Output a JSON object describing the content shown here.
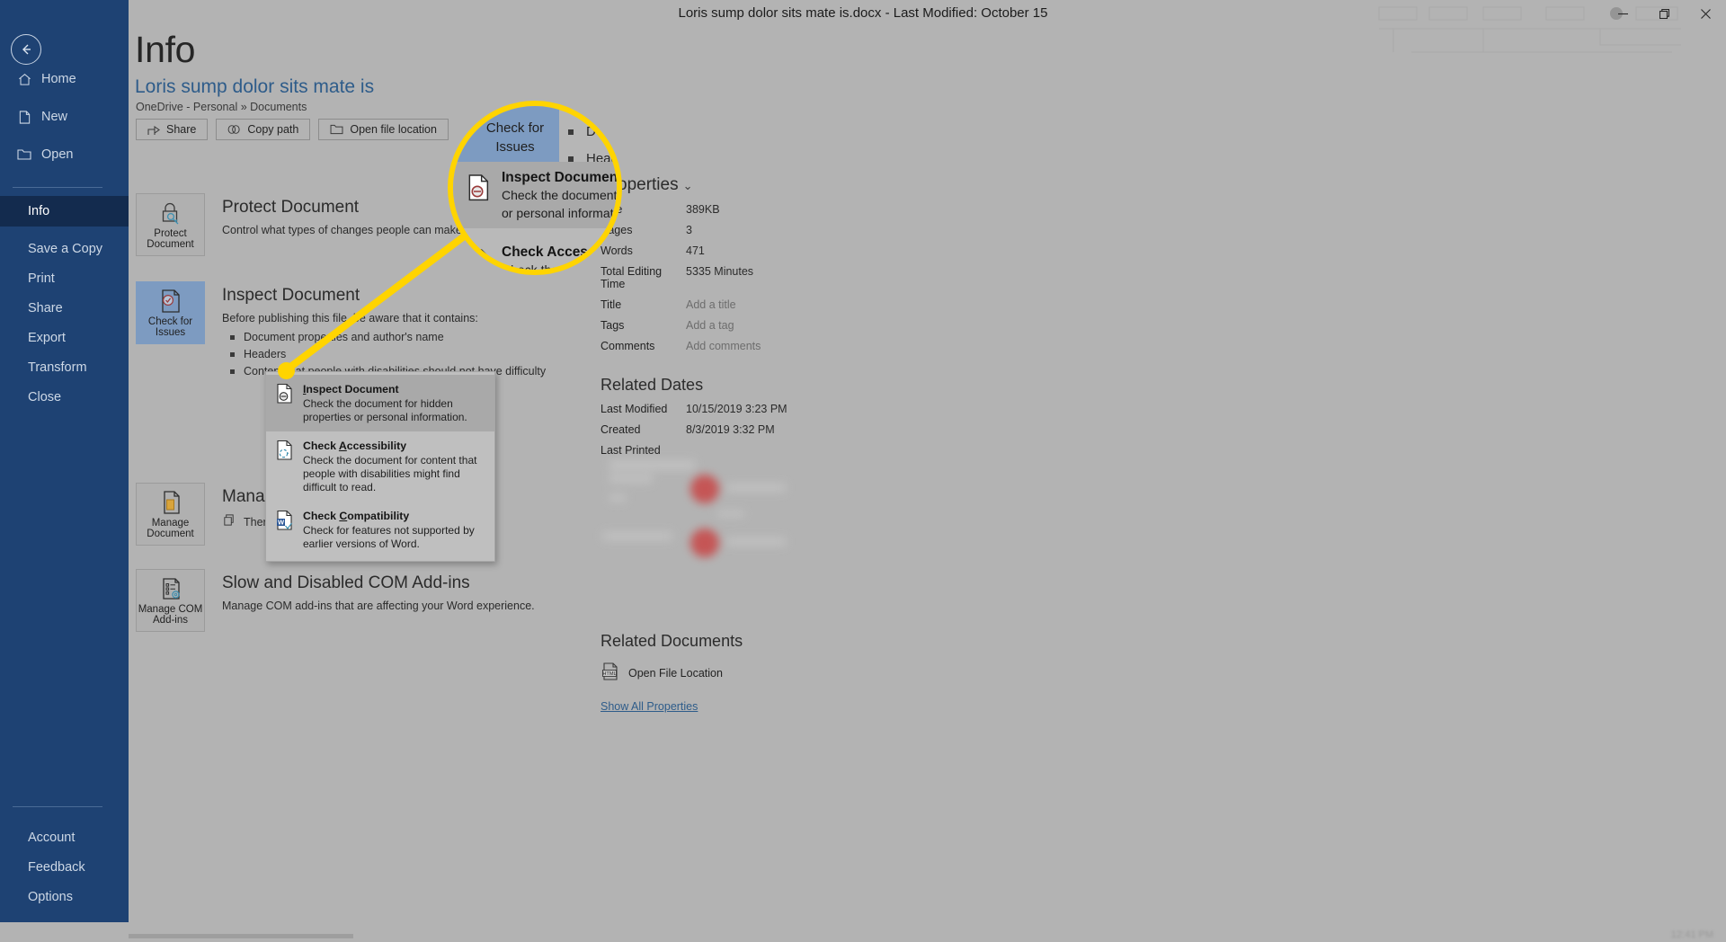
{
  "window": {
    "title": "Loris sump dolor sits mate is.docx  -  Last Modified: October 15",
    "minimize_label": "Minimize",
    "restore_label": "Restore Down",
    "close_label": "Close"
  },
  "sidebar": {
    "back_label": "Back",
    "top_items": [
      {
        "label": "Home",
        "icon": "home-icon"
      },
      {
        "label": "New",
        "icon": "new-document-icon"
      },
      {
        "label": "Open",
        "icon": "open-folder-icon"
      }
    ],
    "main_items": [
      {
        "label": "Info",
        "active": true
      },
      {
        "label": "Save a Copy",
        "active": false
      },
      {
        "label": "Print",
        "active": false
      },
      {
        "label": "Share",
        "active": false
      },
      {
        "label": "Export",
        "active": false
      },
      {
        "label": "Transform",
        "active": false
      },
      {
        "label": "Close",
        "active": false
      }
    ],
    "bottom_items": [
      {
        "label": "Account"
      },
      {
        "label": "Feedback"
      },
      {
        "label": "Options"
      }
    ]
  },
  "page": {
    "title": "Info",
    "document_name": "Loris sump dolor sits mate is",
    "document_path": "OneDrive - Personal » Documents",
    "actions": [
      {
        "label": "Share",
        "icon": "share-icon"
      },
      {
        "label": "Copy path",
        "icon": "link-icon"
      },
      {
        "label": "Open file location",
        "icon": "folder-icon"
      }
    ]
  },
  "sections": {
    "protect": {
      "tile_label": "Protect Document",
      "tile_icon": "lock-key-icon",
      "heading": "Protect Document",
      "description": "Control what types of changes people can make to this document."
    },
    "inspect": {
      "tile_label": "Check for Issues",
      "tile_icon": "document-check-icon",
      "heading": "Inspect Document",
      "description": "Before publishing this file, be aware that it contains:",
      "bullets": [
        "Document properties and author's name",
        "Headers",
        "Content that people with disabilities should not have difficulty"
      ]
    },
    "manage": {
      "tile_label": "Manage Document",
      "tile_icon": "manage-document-icon",
      "heading": "Manage Document",
      "status": "There are no unsaved changes."
    },
    "addins": {
      "tile_label": "Manage COM Add-ins",
      "tile_icon": "com-addins-icon",
      "heading": "Slow and Disabled COM Add-ins",
      "description": "Manage COM add-ins that are affecting your Word experience."
    }
  },
  "dropdown": {
    "items": [
      {
        "title": "Inspect Document",
        "title_pre": "",
        "title_accel": "I",
        "title_post": "nspect Document",
        "description": "Check the document for hidden properties or personal information.",
        "icon": "inspect-document-icon",
        "highlighted": true
      },
      {
        "title": "Check Accessibility",
        "title_pre": "Check ",
        "title_accel": "A",
        "title_post": "ccessibility",
        "description": "Check the document for content that people with disabilities might find difficult to read.",
        "icon": "check-accessibility-icon",
        "highlighted": false
      },
      {
        "title": "Check Compatibility",
        "title_pre": "Check ",
        "title_accel": "C",
        "title_post": "ompatibility",
        "description": "Check for features not supported by earlier versions of Word.",
        "icon": "check-compatibility-icon",
        "highlighted": false
      }
    ]
  },
  "properties": {
    "heading": "Properties",
    "rows": [
      {
        "key": "Size",
        "value": "389KB",
        "placeholder": false
      },
      {
        "key": "Pages",
        "value": "3",
        "placeholder": false
      },
      {
        "key": "Words",
        "value": "471",
        "placeholder": false
      },
      {
        "key": "Total Editing Time",
        "value": "5335 Minutes",
        "placeholder": false
      },
      {
        "key": "Title",
        "value": "Add a title",
        "placeholder": true
      },
      {
        "key": "Tags",
        "value": "Add a tag",
        "placeholder": true
      },
      {
        "key": "Comments",
        "value": "Add comments",
        "placeholder": true
      }
    ],
    "related_dates_heading": "Related Dates",
    "dates": [
      {
        "key": "Last Modified",
        "value": "10/15/2019 3:23 PM"
      },
      {
        "key": "Created",
        "value": "8/3/2019 3:32 PM"
      },
      {
        "key": "Last Printed",
        "value": ""
      }
    ],
    "related_documents_heading": "Related Documents",
    "open_file_location": "Open File Location",
    "open_file_location_icon": "html-file-icon",
    "show_all_properties": "Show All Properties"
  },
  "magnifier": {
    "tile_label": "Check for Issues",
    "bullets": [
      "Document properties and author's name",
      "Headers"
    ],
    "menu": [
      {
        "title": "Inspect Document",
        "line1": "Check the document for hidden properties",
        "line2": "or personal information."
      },
      {
        "title": "Check Accessibility",
        "line1": "Check the document for content that",
        "line2": ""
      }
    ],
    "accent_color": "#ffd400"
  },
  "statusbar": {
    "clock": "12:41 PM"
  }
}
